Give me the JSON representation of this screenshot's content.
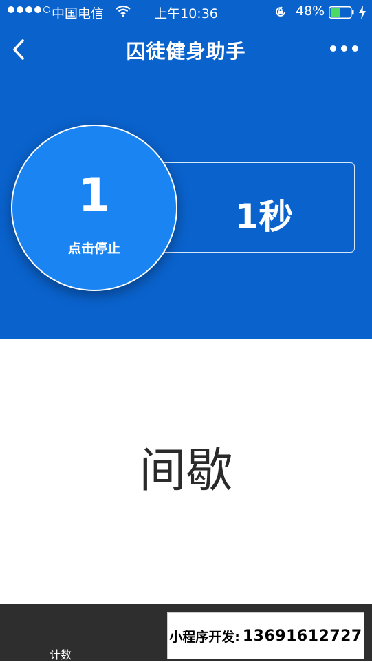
{
  "status_bar": {
    "carrier": "中国电信",
    "time": "上午10:36",
    "battery_percent": "48%",
    "battery_level": 0.48,
    "signal_bars_filled": 4,
    "signal_bars_total": 5,
    "icons": [
      "wifi-icon",
      "rotation-lock-icon",
      "battery-icon",
      "charging-bolt-icon"
    ]
  },
  "nav": {
    "title": "囚徒健身助手",
    "back_icon": "chevron-left-icon",
    "more_icon": "more-dots-icon"
  },
  "counter": {
    "value": "1",
    "action_label": "点击停止"
  },
  "timer": {
    "seconds_label": "1秒"
  },
  "phase": {
    "label": "间歇"
  },
  "bottom_bar": {
    "tab_count_label": "计数"
  },
  "promo": {
    "label": "小程序开发:",
    "phone": "13691612727"
  },
  "colors": {
    "primary_blue": "#0a62cc",
    "circle_blue": "#1a84f2",
    "bottom_bar": "#2e2e2e",
    "battery_green": "#4cd964"
  }
}
